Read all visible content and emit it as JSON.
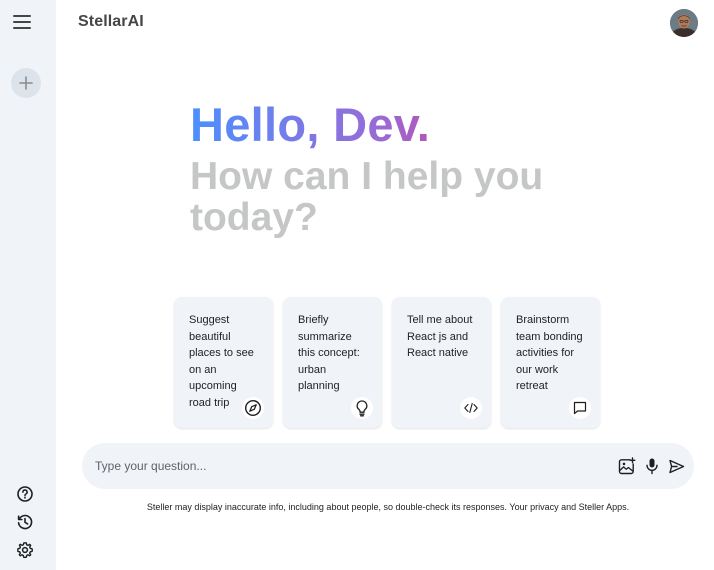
{
  "app": {
    "title": "StellarAI"
  },
  "sidebar": {
    "menu_icon": "hamburger-menu-icon",
    "new_chat_icon": "plus-icon",
    "bottom_icons": [
      "help-icon",
      "history-icon",
      "settings-icon"
    ]
  },
  "greeting": {
    "hello": "Hello, Dev.",
    "subtitle": "How can I help you today?"
  },
  "cards": [
    {
      "text": "Suggest beautiful places to see on an upcoming road trip",
      "icon": "compass-icon"
    },
    {
      "text": "Briefly summarize this concept: urban planning",
      "icon": "lightbulb-icon"
    },
    {
      "text": "Tell me about React js and React native",
      "icon": "code-icon"
    },
    {
      "text": "Brainstorm team bonding activities for our work retreat",
      "icon": "message-icon"
    }
  ],
  "input": {
    "placeholder": "Type your question...",
    "value": "",
    "icons": [
      "add-image-icon",
      "microphone-icon",
      "send-icon"
    ]
  },
  "disclaimer": "Steller may display inaccurate info, including about people, so double-check its responses. Your privacy and Steller Apps."
}
